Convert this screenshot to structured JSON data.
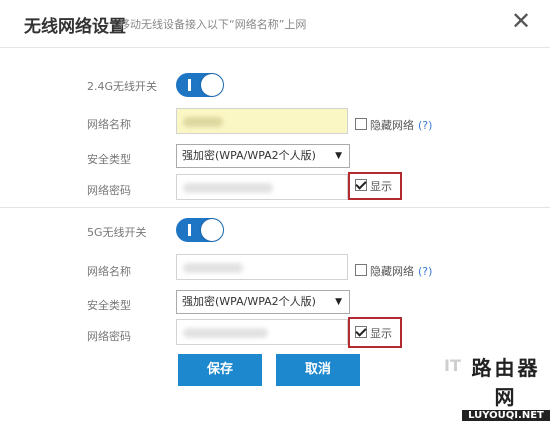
{
  "dialog": {
    "title": "无线网络设置",
    "subtitle": "移动无线设备接入以下“网络名称”上网",
    "close_icon": "close-icon"
  },
  "band_24g": {
    "switch_label": "2.4G无线开关",
    "switch_on": true,
    "ssid_label": "网络名称",
    "hide_network_label": "隐藏网络",
    "hide_network_checked": false,
    "help": "(?)",
    "security_label": "安全类型",
    "security_value": "强加密(WPA/WPA2个人版)",
    "password_label": "网络密码",
    "show_label": "显示",
    "show_checked": true
  },
  "band_5g": {
    "switch_label": "5G无线开关",
    "switch_on": true,
    "ssid_label": "网络名称",
    "hide_network_label": "隐藏网络",
    "hide_network_checked": false,
    "help": "(?)",
    "security_label": "安全类型",
    "security_value": "强加密(WPA/WPA2个人版)",
    "password_label": "网络密码",
    "show_label": "显示",
    "show_checked": true
  },
  "actions": {
    "save_label": "保存",
    "cancel_label": "取消"
  },
  "watermark": {
    "prefix": "IT",
    "cn": "路由器网",
    "en": "LUYOUQI.NET"
  },
  "colors": {
    "accent": "#1e88cf",
    "toggle": "#1e75c3",
    "highlight_border": "#b02a30",
    "autofill_bg": "#fbf7c5"
  }
}
